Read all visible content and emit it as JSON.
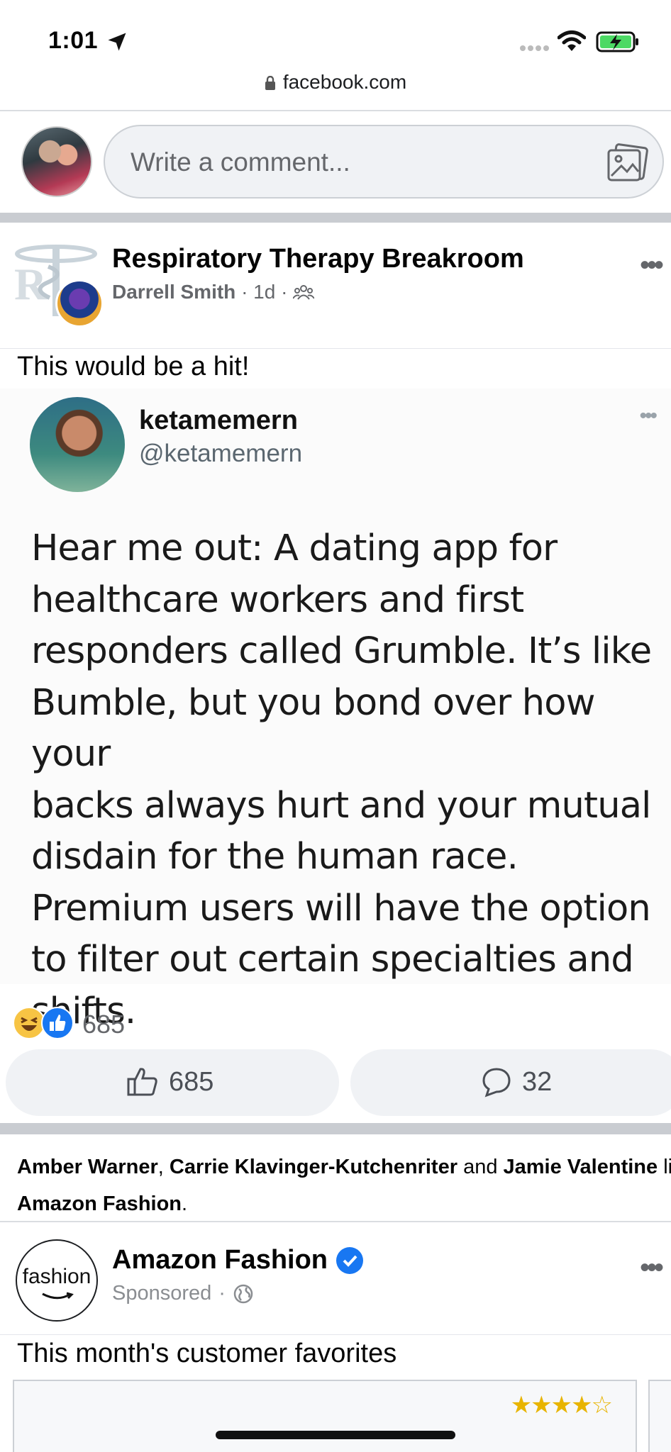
{
  "status_bar": {
    "time": "1:01",
    "url": "facebook.com"
  },
  "composer": {
    "placeholder": "Write a comment..."
  },
  "post": {
    "group_name": "Respiratory Therapy Breakroom",
    "author": "Darrell Smith",
    "time": "1d",
    "caption": "This would be a hit!",
    "tweet": {
      "name": "ketamemern",
      "handle": "@ketamemern",
      "lines": [
        "Hear me out: A dating app for",
        "healthcare workers and first",
        "responders called Grumble. It’s like",
        "Bumble, but you bond over how your",
        "backs always hurt and your mutual",
        "disdain for the human race.",
        "Premium users will have the option",
        "to filter out certain specialties and",
        "shifts."
      ]
    },
    "reaction_count": "685",
    "like_count": "685",
    "comment_count": "32"
  },
  "story": {
    "name1": "Amber Warner",
    "sep1": ", ",
    "name2": "Carrie Klavinger-Kutchenriter",
    "sep2": " and ",
    "name3": "Jamie Valentine",
    "verb": " like",
    "page": "Amazon Fashion",
    "end": "."
  },
  "ad": {
    "logo_text": "fashion",
    "name": "Amazon Fashion",
    "label": "Sponsored",
    "caption": "This month's customer favorites",
    "rating_stars": 4.5
  }
}
